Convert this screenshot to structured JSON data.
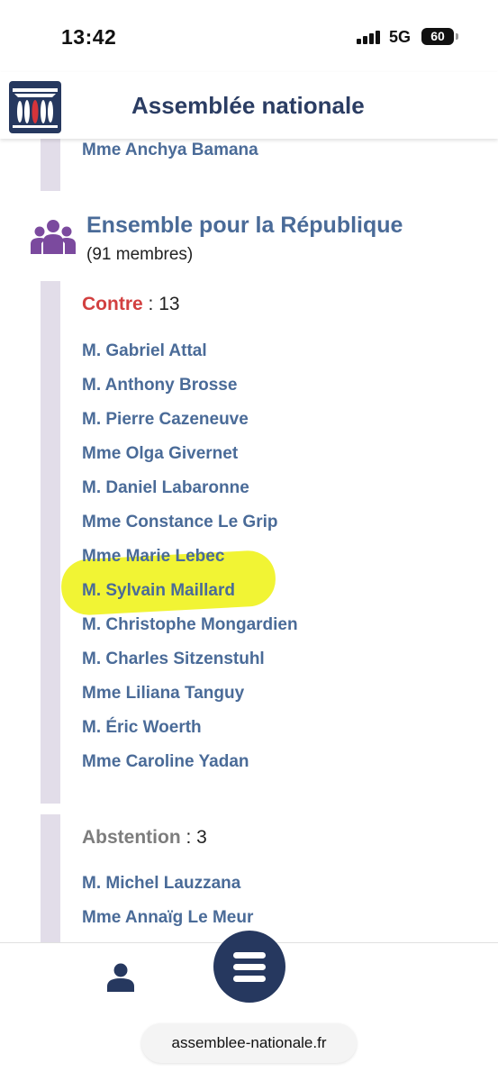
{
  "status_bar": {
    "time": "13:42",
    "network": "5G",
    "battery": "60"
  },
  "header": {
    "title": "Assemblée nationale",
    "logo_icon": "assemblee-logo-icon"
  },
  "previous_group": {
    "last_member": "Mme Anchya Bamana"
  },
  "group": {
    "name": "Ensemble pour la République",
    "members": "(91 membres)",
    "icon": "group-people-icon",
    "icon_color": "#7b4a9e"
  },
  "contre": {
    "label": "Contre",
    "separator": " : ",
    "count": "13",
    "color": "#d24040",
    "members": [
      "M. Gabriel Attal",
      "M. Anthony Brosse",
      "M. Pierre Cazeneuve",
      "Mme Olga Givernet",
      "M. Daniel Labaronne",
      "Mme Constance Le Grip",
      "Mme Marie Lebec",
      "M. Sylvain Maillard",
      "M. Christophe Mongardien",
      "M. Charles Sitzenstuhl",
      "Mme Liliana Tanguy",
      "M. Éric Woerth",
      "Mme Caroline Yadan"
    ],
    "highlighted_member": "M. Sylvain Maillard"
  },
  "abstention": {
    "label": "Abstention",
    "separator": " : ",
    "count": "3",
    "color": "#7d7d7d",
    "members": [
      "M. Michel Lauzzana",
      "Mme Annaïg Le Meur"
    ]
  },
  "bottom_bar": {
    "profile_icon": "user-icon",
    "menu_icon": "menu-icon",
    "url": "assemblee-nationale.fr"
  },
  "colors": {
    "brand_navy": "#26385f",
    "link_blue": "#4a6b98",
    "highlight_yellow": "#eef210",
    "side_bar": "#e2dde9"
  }
}
